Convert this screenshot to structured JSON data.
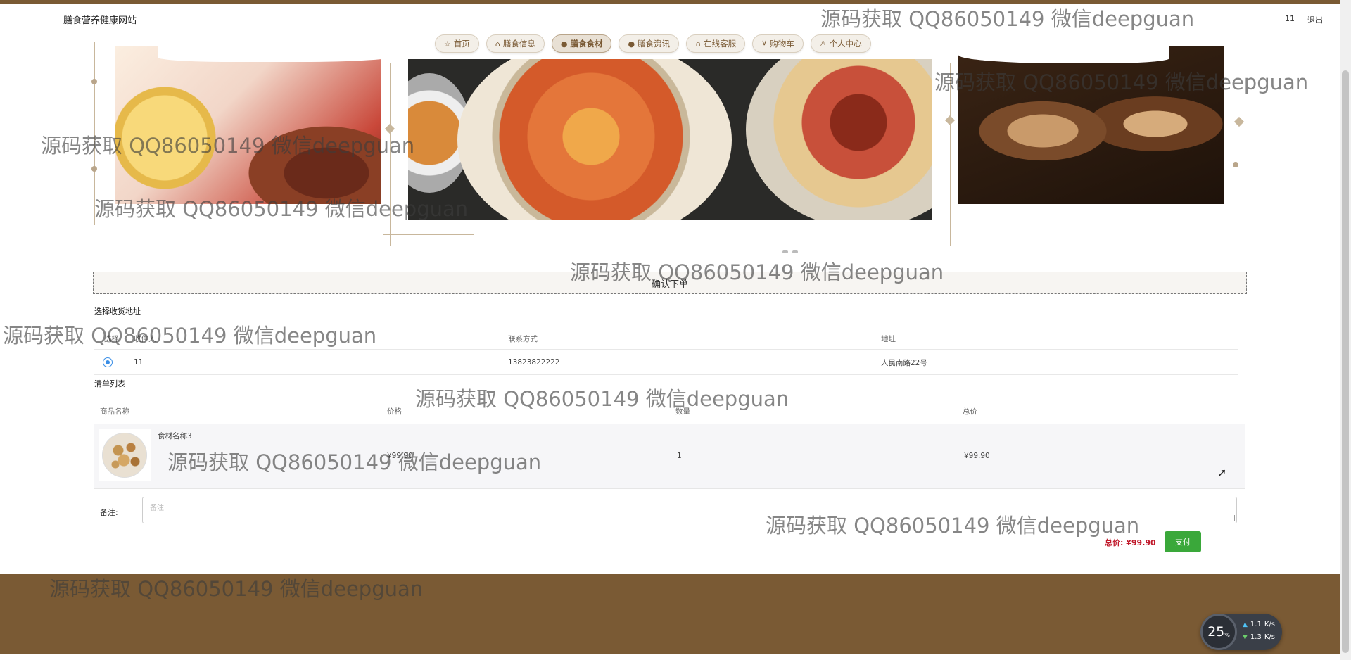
{
  "header": {
    "site_name": "膳食营养健康网站",
    "user_name": "11",
    "logout_label": "退出"
  },
  "nav": {
    "items": [
      {
        "label": "首页",
        "icon": "star-icon"
      },
      {
        "label": "膳食信息",
        "icon": "bag-icon"
      },
      {
        "label": "膳食食材",
        "icon": "info-circle-icon",
        "active": true
      },
      {
        "label": "膳食资讯",
        "icon": "question-circle-icon"
      },
      {
        "label": "在线客服",
        "icon": "headset-icon"
      },
      {
        "label": "购物车",
        "icon": "cart-icon"
      },
      {
        "label": "个人中心",
        "icon": "user-icon"
      }
    ]
  },
  "confirm": {
    "label": "确认下单"
  },
  "address": {
    "section_title": "选择收货地址",
    "columns": [
      "选择",
      "收件人",
      "联系方式",
      "地址"
    ],
    "rows": [
      {
        "name": "11",
        "phone": "13823822222",
        "address": "人民南路22号",
        "selected": true
      }
    ]
  },
  "cart": {
    "section_title": "清单列表",
    "columns": [
      "商品名称",
      "价格",
      "数量",
      "总价"
    ],
    "items": [
      {
        "name": "食材名称3",
        "price": "¥99.90",
        "quantity": "1",
        "total": "¥99.90"
      }
    ]
  },
  "remark": {
    "label": "备注:",
    "placeholder": "备注"
  },
  "summary": {
    "total_label": "总价: ¥99.90",
    "pay_label": "支付"
  },
  "watermark_text": "源码获取 QQ86050149 微信deepguan",
  "net_monitor": {
    "percent": "25",
    "percent_unit": "%",
    "up": "1.1",
    "down": "1.3",
    "unit": "K/s"
  },
  "colors": {
    "brand_brown": "#7a5a34",
    "pay_green": "#3aa83a",
    "price_red": "#c0182a",
    "radio_blue": "#3a8ee6"
  }
}
